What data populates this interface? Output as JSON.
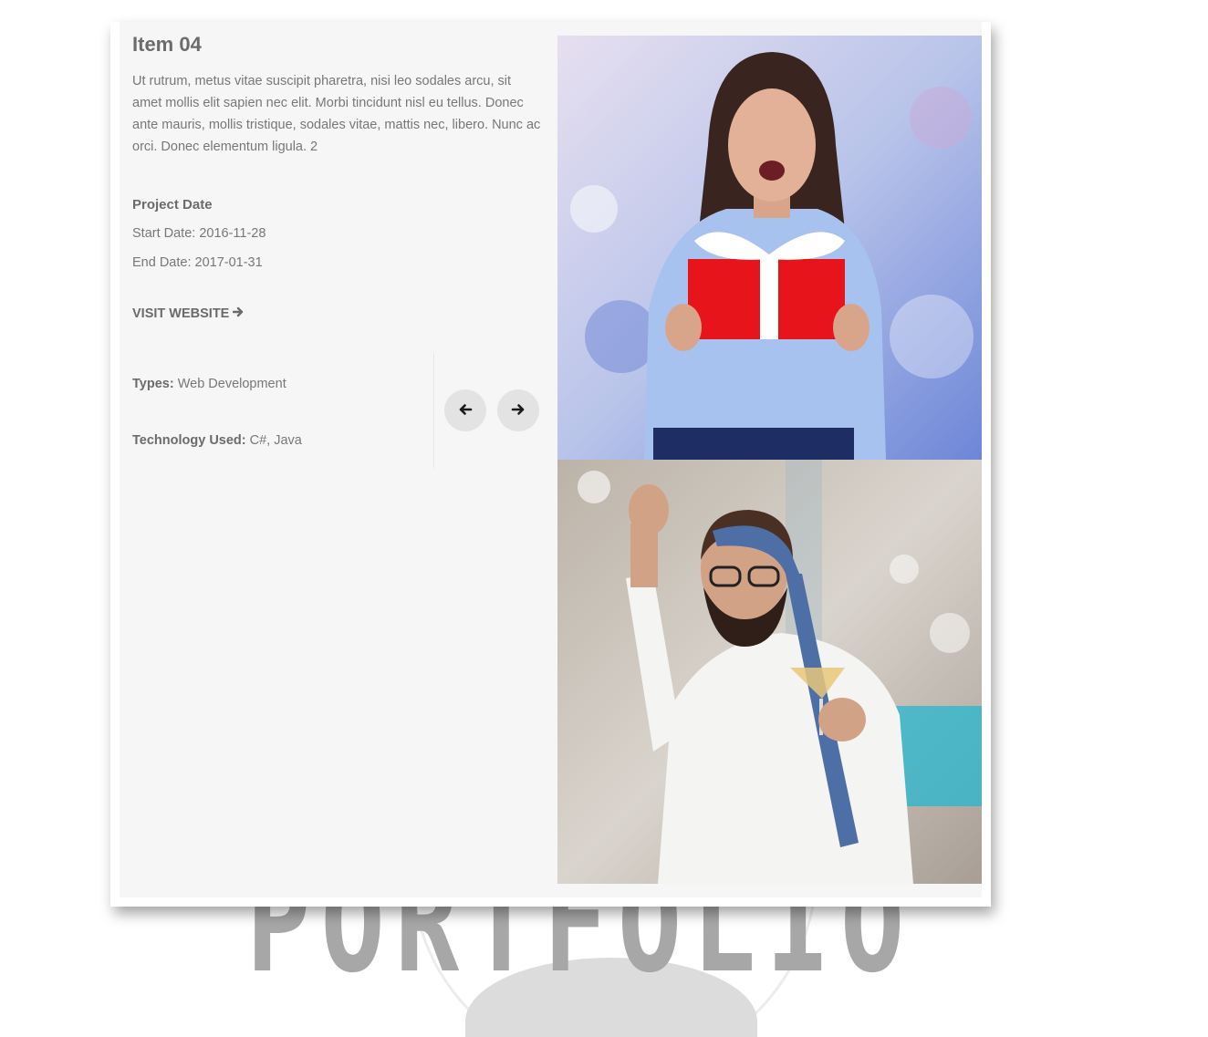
{
  "item": {
    "title": "Item 04",
    "description": "Ut rutrum, metus vitae suscipit pharetra, nisi leo sodales arcu, sit amet mollis elit sapien nec elit. Morbi tincidunt nisl eu tellus. Donec ante mauris, mollis tristique, sodales vitae, mattis nec, libero. Nunc ac orci. Donec elementum ligula. 2"
  },
  "project_date": {
    "heading": "Project Date",
    "start": "Start Date: 2016-11-28",
    "end": "End Date: 2017-01-31"
  },
  "visit_link": {
    "label": "VISIT WEBSITE",
    "icon": "arrow-right-icon"
  },
  "meta": {
    "types_label": "Types:",
    "types_value": "Web Development",
    "tech_label": "Technology Used:",
    "tech_value": "C#, Java"
  },
  "navigation": {
    "prev_icon": "arrow-left-icon",
    "next_icon": "arrow-right-icon"
  },
  "background": {
    "watermark_word": "PORTFOLIO"
  },
  "colors": {
    "panel": "#f6f6f6",
    "text": "#777777",
    "heading": "#6b6b6b",
    "nav_button": "#e3e3e3",
    "gift": "#e8141c"
  }
}
